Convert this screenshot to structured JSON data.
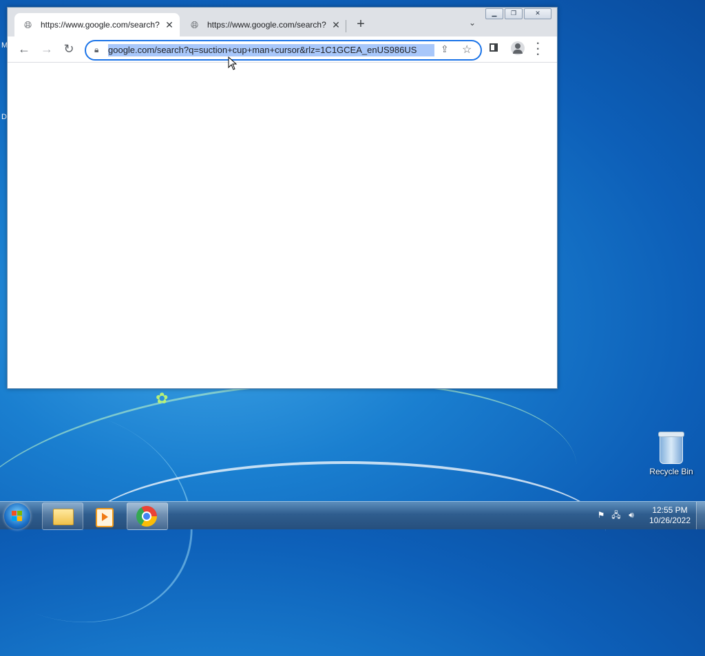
{
  "desktop": {
    "left_edge_texts": [
      "M",
      "D"
    ],
    "recycle_bin_label": "Recycle Bin"
  },
  "browser": {
    "tabs": [
      {
        "title": "https://www.google.com/search?",
        "active": true
      },
      {
        "title": "https://www.google.com/search?",
        "active": false
      }
    ],
    "new_tab_symbol": "+",
    "tab_list_symbol": "⌄",
    "window_controls": {
      "minimize": "▁",
      "restore": "❐",
      "close": "✕"
    },
    "address_bar": {
      "url": "google.com/search?q=suction+cup+man+cursor&rlz=1C1GCEA_enUS986US",
      "selected": true
    },
    "nav": {
      "back": "←",
      "forward": "→",
      "reload": "↻"
    },
    "icons": {
      "lock": "lock-icon",
      "share": "share-icon",
      "bookmark": "star-icon",
      "side_panel": "side-panel-icon",
      "profile": "profile-icon",
      "menu": "kebab-menu-icon"
    },
    "colors": {
      "accent": "#1a73e8",
      "selection": "#a8c7fa",
      "tabstrip": "#dee1e6"
    }
  },
  "taskbar": {
    "pinned": [
      "windows-explorer",
      "windows-media-player",
      "google-chrome"
    ],
    "clock": {
      "time": "12:55 PM",
      "date": "10/26/2022"
    }
  }
}
